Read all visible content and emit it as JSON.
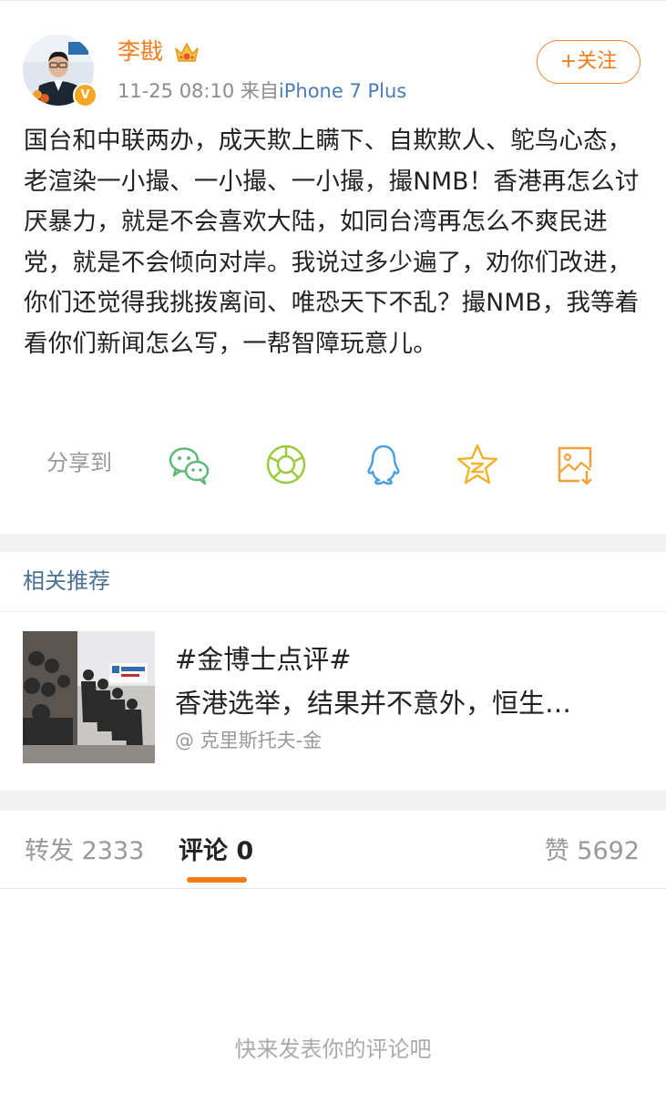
{
  "post": {
    "author": {
      "name": "李戡",
      "verified_badge": "V",
      "vip_icon": "crown-icon",
      "accent": "#f07d1a"
    },
    "time": "11-25 08:10",
    "source_prefix": "来自",
    "source": "iPhone 7 Plus",
    "follow_label": "+关注",
    "text": "国台和中联两办，成天欺上瞒下、自欺欺人、鸵鸟心态，老渲染一小撮、一小撮、一小撮，撮NMB！香港再怎么讨厌暴力，就是不会喜欢大陆，如同台湾再怎么不爽民进党，就是不会倾向对岸。我说过多少遍了，劝你们改进，你们还觉得我挑拨离间、唯恐天下不乱？撮NMB，我等着看你们新闻怎么写，一帮智障玩意儿。"
  },
  "share": {
    "label": "分享到",
    "icons": [
      "wechat-icon",
      "moments-icon",
      "qq-icon",
      "qzone-icon",
      "save-image-icon"
    ]
  },
  "related": {
    "title": "相关推荐",
    "hashtag": "#金博士点评#",
    "headline": "香港选举，结果并不意外，恒生…",
    "author": "@ 克里斯托夫-金"
  },
  "tabs": {
    "repost": "转发 2333",
    "comments": "评论 0",
    "likes": "赞 5692"
  },
  "comments_empty": "快来发表你的评论吧"
}
